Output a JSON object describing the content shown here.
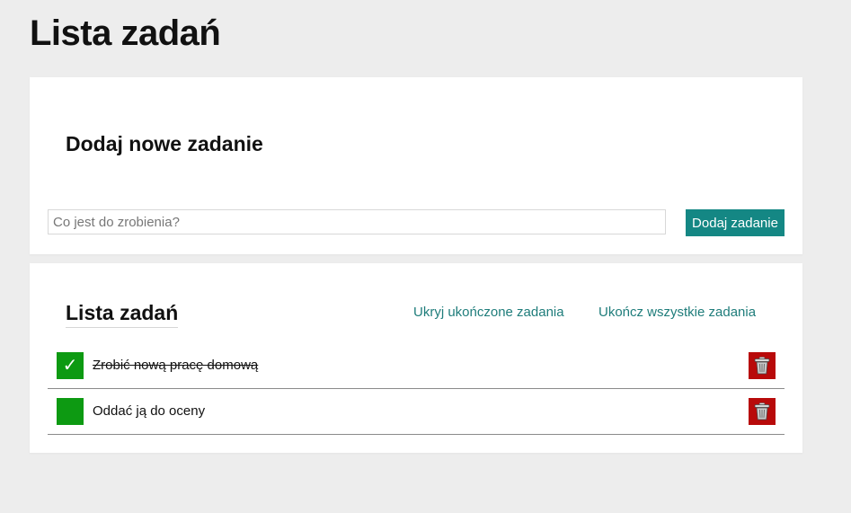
{
  "page": {
    "title": "Lista zadań"
  },
  "add_section": {
    "title": "Dodaj nowe zadanie",
    "input": {
      "value": "",
      "placeholder": "Co jest do zrobienia?"
    },
    "add_button_label": "Dodaj zadanie"
  },
  "list_section": {
    "title": "Lista zadań",
    "hide_completed_label": "Ukryj ukończone zadania",
    "complete_all_label": "Ukończ wszystkie zadania",
    "tasks": [
      {
        "text": "Zrobić nową pracę domową",
        "completed": true,
        "check_glyph": "✓"
      },
      {
        "text": "Oddać ją do oceny",
        "completed": false,
        "check_glyph": ""
      }
    ]
  },
  "colors": {
    "background": "#ededed",
    "accent": "#148784",
    "checkbox": "#0d9a12",
    "delete": "#b80a0a"
  },
  "icons": {
    "checkbox": "check-icon",
    "delete": "trash-icon"
  }
}
